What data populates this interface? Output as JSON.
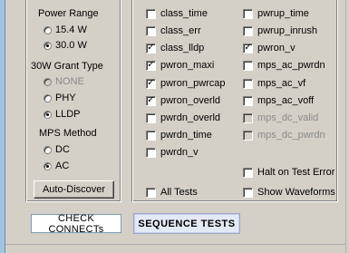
{
  "left_panel": {
    "power_range": {
      "label": "Power Range",
      "options": [
        {
          "label": "15.4 W",
          "checked": false,
          "disabled": false
        },
        {
          "label": "30.0 W",
          "checked": true,
          "disabled": false
        }
      ]
    },
    "grant_type": {
      "label": "30W Grant Type",
      "options": [
        {
          "label": "NONE",
          "checked": false,
          "disabled": true
        },
        {
          "label": "PHY",
          "checked": false,
          "disabled": false
        },
        {
          "label": "LLDP",
          "checked": true,
          "disabled": false
        }
      ]
    },
    "mps_method": {
      "label": "MPS Method",
      "options": [
        {
          "label": "DC",
          "checked": false,
          "disabled": false
        },
        {
          "label": "AC",
          "checked": true,
          "disabled": false
        }
      ]
    },
    "auto_discover_label": "Auto-Discover"
  },
  "tests": {
    "col1": [
      {
        "label": "class_time",
        "checked": false,
        "disabled": false
      },
      {
        "label": "class_err",
        "checked": false,
        "disabled": false
      },
      {
        "label": "class_lldp",
        "checked": true,
        "disabled": false
      },
      {
        "label": "pwron_maxi",
        "checked": true,
        "disabled": false
      },
      {
        "label": "pwron_pwrcap",
        "checked": true,
        "disabled": false
      },
      {
        "label": "pwron_overld",
        "checked": true,
        "disabled": false
      },
      {
        "label": "pwrdn_overld",
        "checked": false,
        "disabled": false
      },
      {
        "label": "pwrdn_time",
        "checked": false,
        "disabled": false
      },
      {
        "label": "pwrdn_v",
        "checked": false,
        "disabled": false
      }
    ],
    "col2": [
      {
        "label": "pwrup_time",
        "checked": false,
        "disabled": false
      },
      {
        "label": "pwrup_inrush",
        "checked": false,
        "disabled": false
      },
      {
        "label": "pwron_v",
        "checked": true,
        "disabled": false
      },
      {
        "label": "mps_ac_pwrdn",
        "checked": false,
        "disabled": false
      },
      {
        "label": "mps_ac_vf",
        "checked": false,
        "disabled": false
      },
      {
        "label": "mps_ac_voff",
        "checked": false,
        "disabled": false
      },
      {
        "label": "mps_dc_valid",
        "checked": false,
        "disabled": true
      },
      {
        "label": "mps_dc_pwrdn",
        "checked": false,
        "disabled": true
      }
    ],
    "halt_on_error": {
      "label": "Halt on Test Error",
      "checked": false
    },
    "all_tests": {
      "label": "All Tests",
      "checked": false
    },
    "show_waveforms": {
      "label": "Show Waveforms",
      "checked": false
    }
  },
  "buttons": {
    "check_connects_label": "CHECK CONNECTs",
    "sequence_tests_label": "SEQUENCE TESTS"
  }
}
